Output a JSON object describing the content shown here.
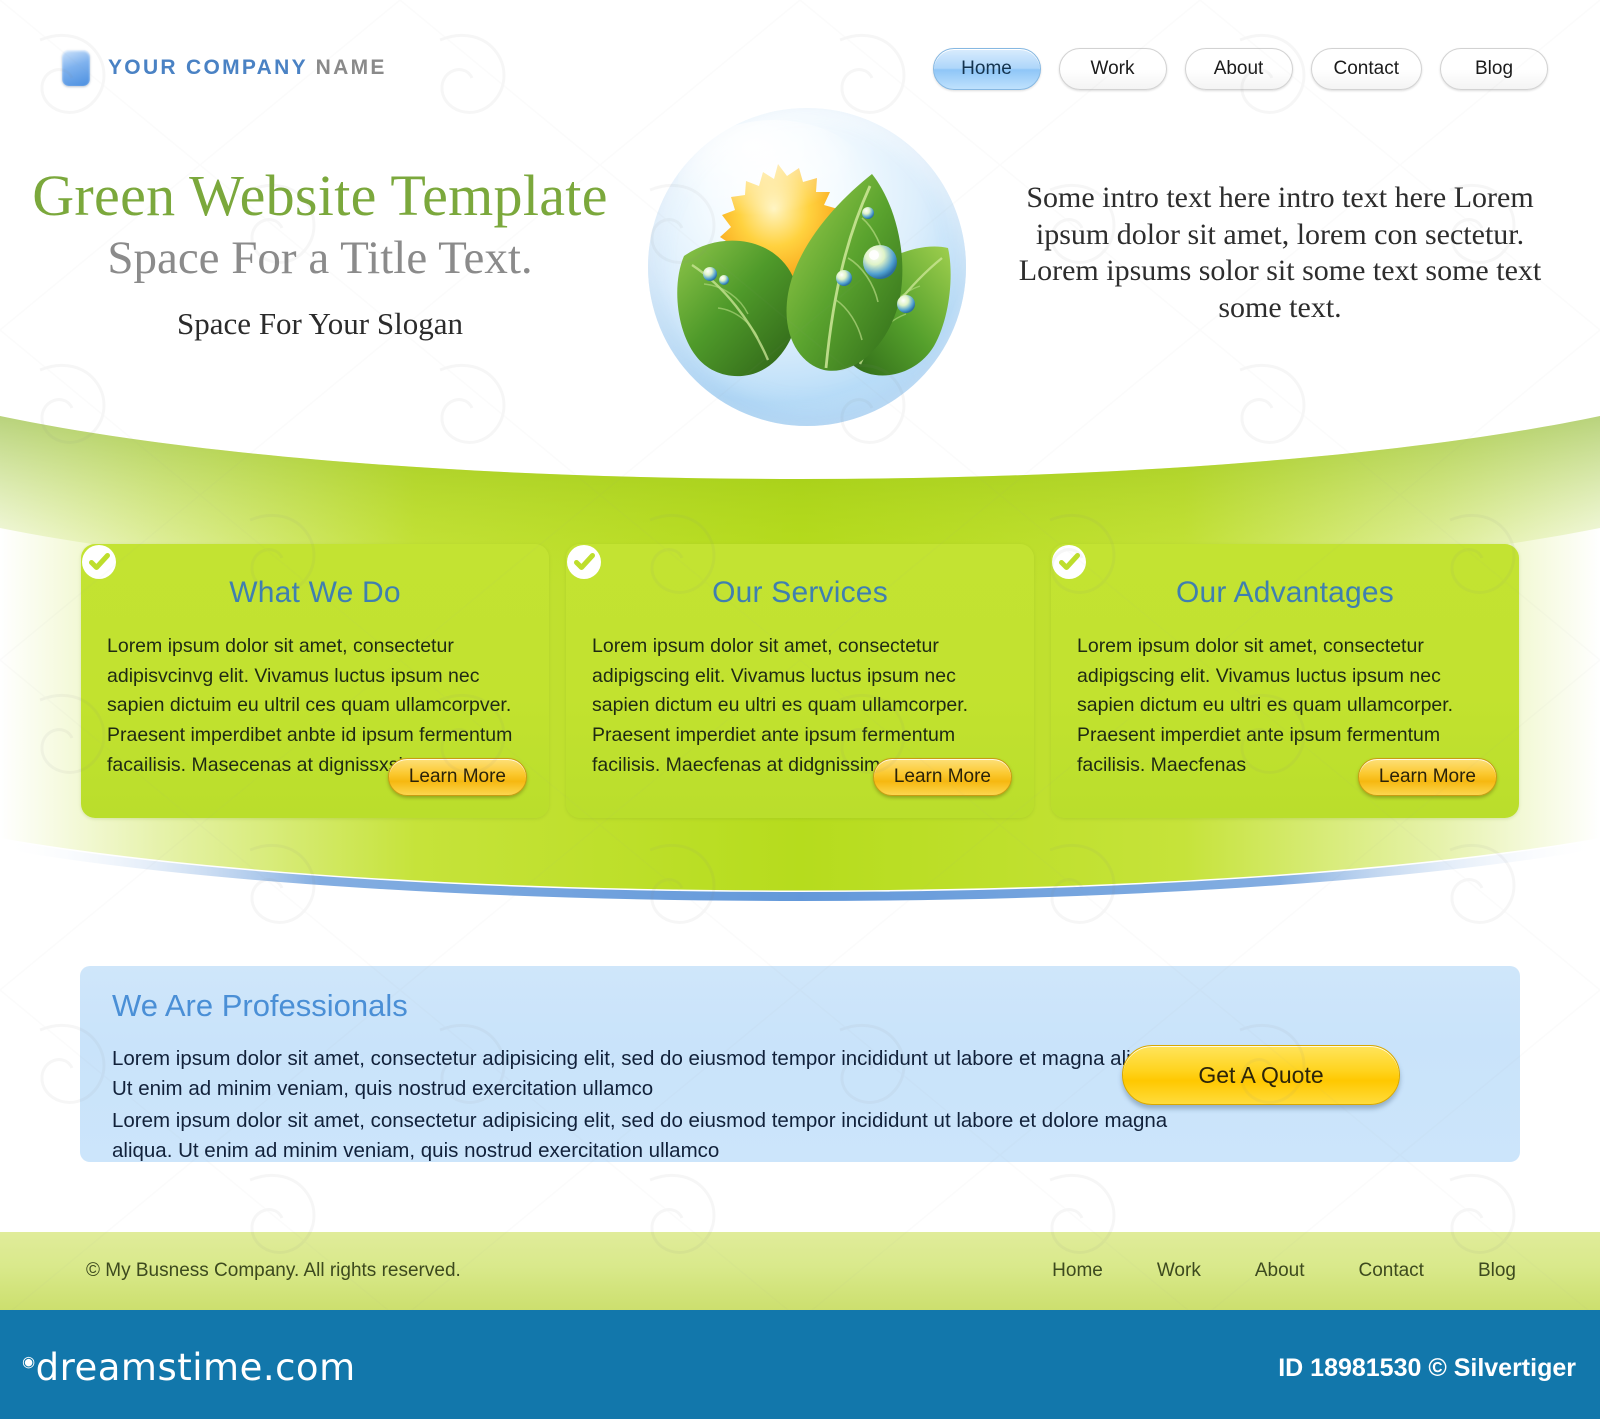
{
  "header": {
    "brand_blue": "YOUR COMPANY",
    "brand_gray": "NAME",
    "nav": [
      {
        "label": "Home",
        "active": true
      },
      {
        "label": "Work",
        "active": false
      },
      {
        "label": "About",
        "active": false
      },
      {
        "label": "Contact",
        "active": false
      },
      {
        "label": "Blog",
        "active": false
      }
    ]
  },
  "hero": {
    "title": "Green Website Template",
    "subtitle": "Space For a Title Text.",
    "slogan": "Space For Your Slogan",
    "intro": "Some intro text here intro text here Lorem ipsum dolor sit amet, lorem con sectetur. Lorem ipsums solor sit some text some text some text.",
    "logo_icon": "leaf-sun-sphere-icon"
  },
  "cards": [
    {
      "icon": "check-circle-icon",
      "title": "What We Do",
      "body": "Lorem ipsum dolor sit amet, consectetur adipisvcinvg elit. Vivamus luctus ipsum nec sapien dictuim eu ultril ces quam ullamcorpver. Praesent imperdibet anbte id ipsum fermentum facailisis. Masecenas at dignissxsim",
      "button": "Learn More"
    },
    {
      "icon": "check-circle-icon",
      "title": "Our Services",
      "body": "Lorem ipsum dolor sit amet, consectetur adipigscing elit. Vivamus luctus ipsum nec sapien dictum eu ultri es quam ullamcorper. Praesent imperdiet ante ipsum fermentum facilisis. Maecfenas at didgnissim",
      "button": "Learn More"
    },
    {
      "icon": "check-circle-icon",
      "title": "Our Advantages",
      "body": "Lorem ipsum dolor sit amet, consectetur adipigscing elit. Vivamus luctus ipsum nec sapien dictum eu ultri es quam ullamcorper. Praesent imperdiet ante ipsum fermentum facilisis. Maecfenas",
      "button": "Learn More"
    }
  ],
  "professionals": {
    "title": "We Are Professionals",
    "paragraph1": "Lorem ipsum dolor sit amet, consectetur adipisicing elit, sed do eiusmod tempor incididunt ut labore et magna aliqua. Ut enim ad minim veniam, quis nostrud exercitation ullamco",
    "paragraph2": "Lorem ipsum dolor sit amet, consectetur adipisicing elit, sed do eiusmod tempor incididunt ut labore et dolore magna aliqua. Ut enim ad minim veniam, quis nostrud exercitation ullamco",
    "quote_button": "Get A Quote"
  },
  "footer": {
    "copyright": "© My Busness Company. All rights reserved.",
    "nav": [
      "Home",
      "Work",
      "About",
      "Contact",
      "Blog"
    ]
  },
  "watermark_bar": {
    "logo": "dreamstime.com",
    "id_text": "ID 18981530 © Silvertiger"
  },
  "colors": {
    "green_band": "#b9de22",
    "card_green": "#c2e22f",
    "card_title_blue": "#3f7fb0",
    "hero_title_green": "#7ba83c",
    "hero_sub_gray": "#8b8b8b",
    "panel_blue": "#cce5fb",
    "panel_title_blue": "#4a8fd6",
    "button_yellow": "#ffd41f",
    "footer_green": "#d9e98b",
    "dreamstime_blue": "#1277ab",
    "nav_active_blue": "#aed6fa"
  }
}
